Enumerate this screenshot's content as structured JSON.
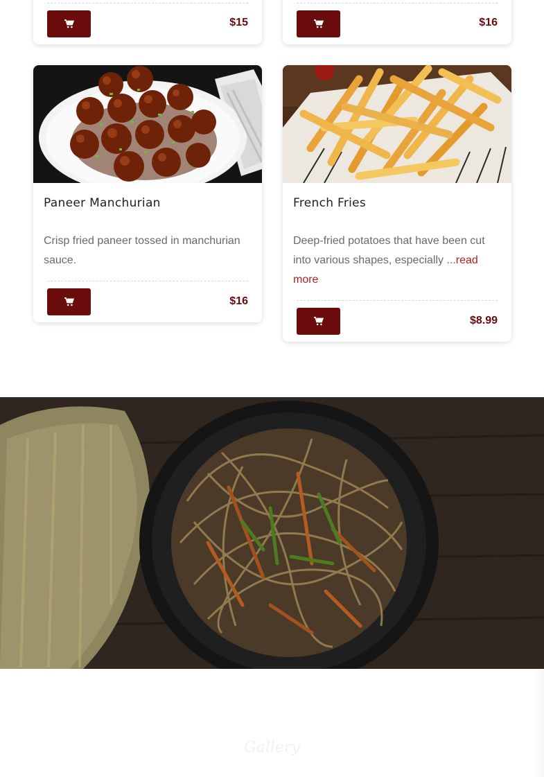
{
  "top_cards": [
    {
      "price": "$15",
      "cart_icon": "cart-icon"
    },
    {
      "price": "$16",
      "cart_icon": "cart-icon"
    }
  ],
  "cards": [
    {
      "title": "Paneer Manchurian",
      "description": "Crisp fried paneer tossed in manchurian sauce.",
      "read_more": "",
      "price": "$16",
      "image": "paneer-manchurian-photo"
    },
    {
      "title": "French Fries",
      "description": "Deep-fried potatoes that have been cut into various shapes, especially ...",
      "read_more": "read more",
      "price": "$8.99",
      "image": "french-fries-photo"
    }
  ],
  "banner": {
    "image": "hakka-noodles-photo"
  },
  "gallery": {
    "title": "Gallery"
  },
  "colors": {
    "accent": "#6b0c0c",
    "link": "#b5201e",
    "text_muted": "#6a6a6a"
  }
}
